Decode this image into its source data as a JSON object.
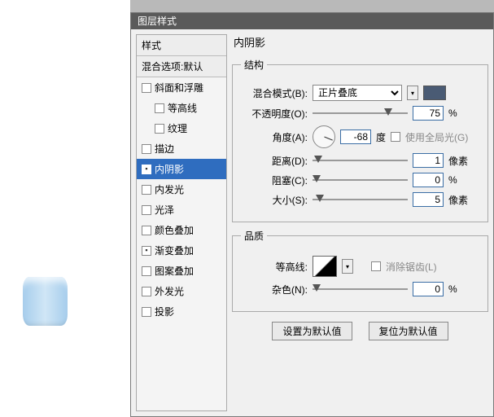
{
  "dialog": {
    "title": "图层样式"
  },
  "styles": {
    "header": "样式",
    "blend_defaults": "混合选项:默认",
    "items": [
      {
        "label": "斜面和浮雕",
        "checked": false,
        "indent": false
      },
      {
        "label": "等高线",
        "checked": false,
        "indent": true
      },
      {
        "label": "纹理",
        "checked": false,
        "indent": true
      },
      {
        "label": "描边",
        "checked": false,
        "indent": false
      },
      {
        "label": "内阴影",
        "checked": true,
        "indent": false,
        "selected": true
      },
      {
        "label": "内发光",
        "checked": false,
        "indent": false
      },
      {
        "label": "光泽",
        "checked": false,
        "indent": false
      },
      {
        "label": "颜色叠加",
        "checked": false,
        "indent": false
      },
      {
        "label": "渐变叠加",
        "checked": true,
        "indent": false
      },
      {
        "label": "图案叠加",
        "checked": false,
        "indent": false
      },
      {
        "label": "外发光",
        "checked": false,
        "indent": false
      },
      {
        "label": "投影",
        "checked": false,
        "indent": false
      }
    ]
  },
  "panel": {
    "title": "内阴影",
    "structure": {
      "legend": "结构",
      "blend_mode": {
        "label": "混合模式(B):",
        "value": "正片叠底",
        "color": "#4a5b74"
      },
      "opacity": {
        "label": "不透明度(O):",
        "value": "75",
        "unit": "%",
        "pos": 75
      },
      "angle": {
        "label": "角度(A):",
        "value": "-68",
        "unit": "度",
        "global": {
          "label": "使用全局光(G)",
          "checked": false
        }
      },
      "distance": {
        "label": "距离(D):",
        "value": "1",
        "unit": "像素",
        "pos": 2
      },
      "choke": {
        "label": "阻塞(C):",
        "value": "0",
        "unit": "%",
        "pos": 0
      },
      "size": {
        "label": "大小(S):",
        "value": "5",
        "unit": "像素",
        "pos": 3
      }
    },
    "quality": {
      "legend": "品质",
      "contour": {
        "label": "等高线:",
        "antialias": {
          "label": "消除锯齿(L)",
          "checked": false
        }
      },
      "noise": {
        "label": "杂色(N):",
        "value": "0",
        "unit": "%",
        "pos": 0
      }
    },
    "buttons": {
      "make_default": "设置为默认值",
      "reset_default": "复位为默认值"
    }
  }
}
